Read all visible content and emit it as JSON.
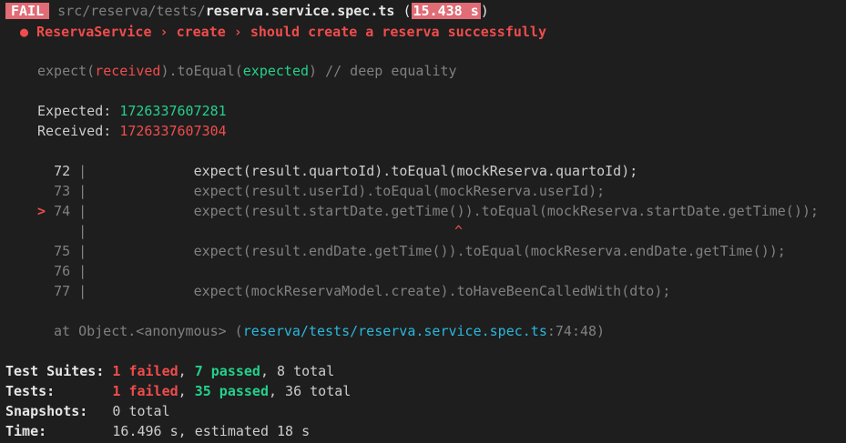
{
  "header": {
    "badge": "FAIL",
    "path_dir": "src/reserva/tests/",
    "path_file": "reserva.service.spec.ts",
    "time_open": "(",
    "time_value": "15.438 s",
    "time_close": ")"
  },
  "test_title": "● ReservaService › create › should create a reserva successfully",
  "assertion": {
    "expect_open": "expect(",
    "received": "received",
    "to_equal": ").toEqual(",
    "expected": "expected",
    "close": ")",
    "comment": " // deep equality"
  },
  "diff": {
    "expected_label": "Expected: ",
    "expected_value": "1726337607281",
    "received_label": "Received: ",
    "received_value": "1726337607304"
  },
  "code_lines": [
    {
      "marker": "  ",
      "num": "72",
      "code": "expect(result.quartoId).toEqual(mockReserva.quartoId);"
    },
    {
      "marker": "  ",
      "num": "73",
      "code": "expect(result.userId).toEqual(mockReserva.userId);"
    },
    {
      "marker": "> ",
      "num": "74",
      "code": "expect(result.startDate.getTime()).toEqual(mockReserva.startDate.getTime());"
    },
    {
      "marker": "  ",
      "num": "",
      "code": ""
    },
    {
      "marker": "  ",
      "num": "75",
      "code": "expect(result.endDate.getTime()).toEqual(mockReserva.endDate.getTime());"
    },
    {
      "marker": "  ",
      "num": "76",
      "code": ""
    },
    {
      "marker": "  ",
      "num": "77",
      "code": "expect(mockReservaModel.create).toHaveBeenCalledWith(dto);"
    }
  ],
  "caret": "^",
  "stack": {
    "prefix": "at Object.<anonymous> (",
    "file": "reserva/tests/reserva.service.spec.ts",
    "location": ":74:48",
    "suffix": ")"
  },
  "summary": {
    "suites_label": "Test Suites: ",
    "suites_failed": "1 failed",
    "suites_passed": "7 passed",
    "suites_total": ", 8 total",
    "tests_label": "Tests:       ",
    "tests_failed": "1 failed",
    "tests_passed": "35 passed",
    "tests_total": ", 36 total",
    "snapshots_label": "Snapshots:   ",
    "snapshots_value": "0 total",
    "time_label": "Time:        ",
    "time_value": "16.496 s, estimated 18 s",
    "comma": ", "
  },
  "colors": {
    "background": "#1e1e1e",
    "fail_badge": "#e06c75",
    "red": "#f14c4c",
    "green": "#23d18b",
    "cyan": "#29b8db",
    "yellow": "#e5e510"
  }
}
